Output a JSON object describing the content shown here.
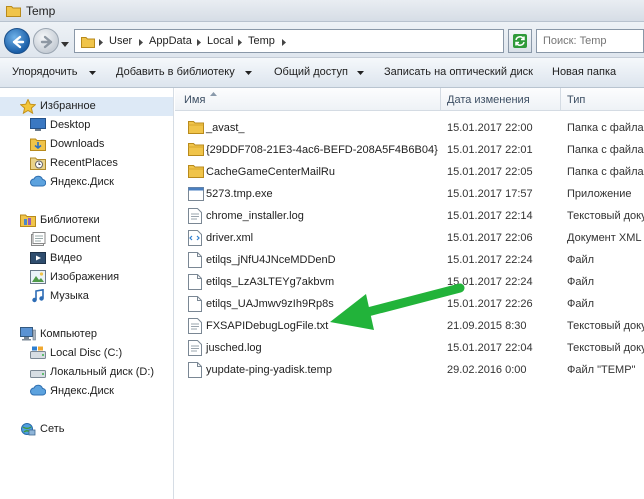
{
  "window": {
    "title": "Temp"
  },
  "address": {
    "crumbs": [
      "User",
      "AppData",
      "Local",
      "Temp"
    ],
    "search_placeholder": "Поиск: Temp"
  },
  "toolbar": {
    "items": [
      "Упорядочить",
      "Добавить в библиотеку",
      "Общий доступ",
      "Записать на оптический диск",
      "Новая папка"
    ]
  },
  "sidebar": {
    "favorites": {
      "label": "Избранное",
      "items": [
        "Desktop",
        "Downloads",
        "RecentPlaces",
        "Яндекс.Диск"
      ]
    },
    "libraries": {
      "label": "Библиотеки",
      "items": [
        "Document",
        "Видео",
        "Изображения",
        "Музыка"
      ]
    },
    "computer": {
      "label": "Компьютер",
      "items": [
        "Local Disc (C:)",
        "Локальный диск (D:)",
        "Яндекс.Диск"
      ]
    },
    "network": {
      "label": "Сеть"
    }
  },
  "columns": {
    "name": "Имя",
    "date": "Дата изменения",
    "type": "Тип"
  },
  "files": [
    {
      "name": "_avast_",
      "date": "15.01.2017 22:00",
      "type": "Папка с файлами",
      "icon": "folder-icon"
    },
    {
      "name": "{29DDF708-21E3-4ac6-BEFD-208A5F4B6B04}",
      "date": "15.01.2017 22:01",
      "type": "Папка с файлами",
      "icon": "folder-icon"
    },
    {
      "name": "CacheGameCenterMailRu",
      "date": "15.01.2017 22:05",
      "type": "Папка с файлами",
      "icon": "folder-icon"
    },
    {
      "name": "5273.tmp.exe",
      "date": "15.01.2017 17:57",
      "type": "Приложение",
      "icon": "exe-icon"
    },
    {
      "name": "chrome_installer.log",
      "date": "15.01.2017 22:14",
      "type": "Текстовый документ",
      "icon": "text-file-icon"
    },
    {
      "name": "driver.xml",
      "date": "15.01.2017 22:06",
      "type": "Документ XML",
      "icon": "xml-file-icon"
    },
    {
      "name": "etilqs_jNfU4JNceMDDenD",
      "date": "15.01.2017 22:24",
      "type": "Файл",
      "icon": "file-icon"
    },
    {
      "name": "etilqs_LzA3LTEYg7akbvm",
      "date": "15.01.2017 22:24",
      "type": "Файл",
      "icon": "file-icon"
    },
    {
      "name": "etilqs_UAJmwv9zIh9Rp8s",
      "date": "15.01.2017 22:26",
      "type": "Файл",
      "icon": "file-icon"
    },
    {
      "name": "FXSAPIDebugLogFile.txt",
      "date": "21.09.2015 8:30",
      "type": "Текстовый документ",
      "icon": "text-file-icon"
    },
    {
      "name": "jusched.log",
      "date": "15.01.2017 22:04",
      "type": "Текстовый документ",
      "icon": "text-file-icon"
    },
    {
      "name": "yupdate-ping-yadisk.temp",
      "date": "29.02.2016 0:00",
      "type": "Файл \"TEMP\"",
      "icon": "file-icon"
    }
  ],
  "colors": {
    "annotation_arrow": "#22b33a",
    "selection": "#dde9f6",
    "folder": "#e8b830"
  }
}
